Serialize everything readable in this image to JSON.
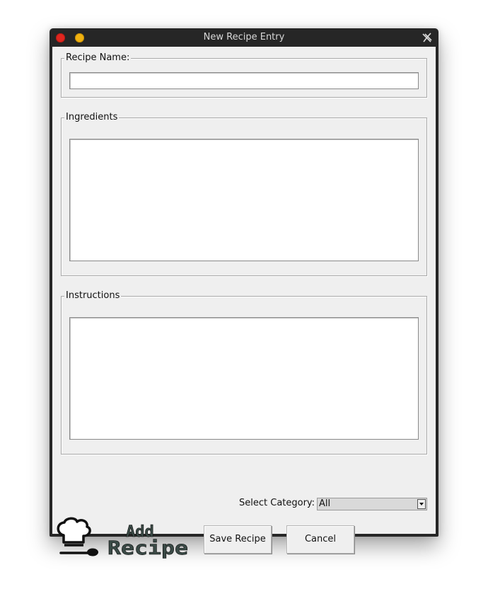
{
  "window": {
    "title": "New Recipe Entry"
  },
  "recipe_name": {
    "label": "Recipe Name:",
    "value": ""
  },
  "ingredients": {
    "label": "Ingredients",
    "value": ""
  },
  "instructions": {
    "label": "Instructions",
    "value": ""
  },
  "category": {
    "label": "Select Category:",
    "selected": "All"
  },
  "logo": {
    "text_line1": "Add",
    "text_line2": "Recipe",
    "icon": "chef-hat-spoon-icon"
  },
  "buttons": {
    "save_label": "Save Recipe",
    "cancel_label": "Cancel"
  },
  "colors": {
    "close_button": "#e0261f",
    "minimize_button": "#f0b110",
    "titlebar": "#262626",
    "window_background": "#efefef"
  }
}
